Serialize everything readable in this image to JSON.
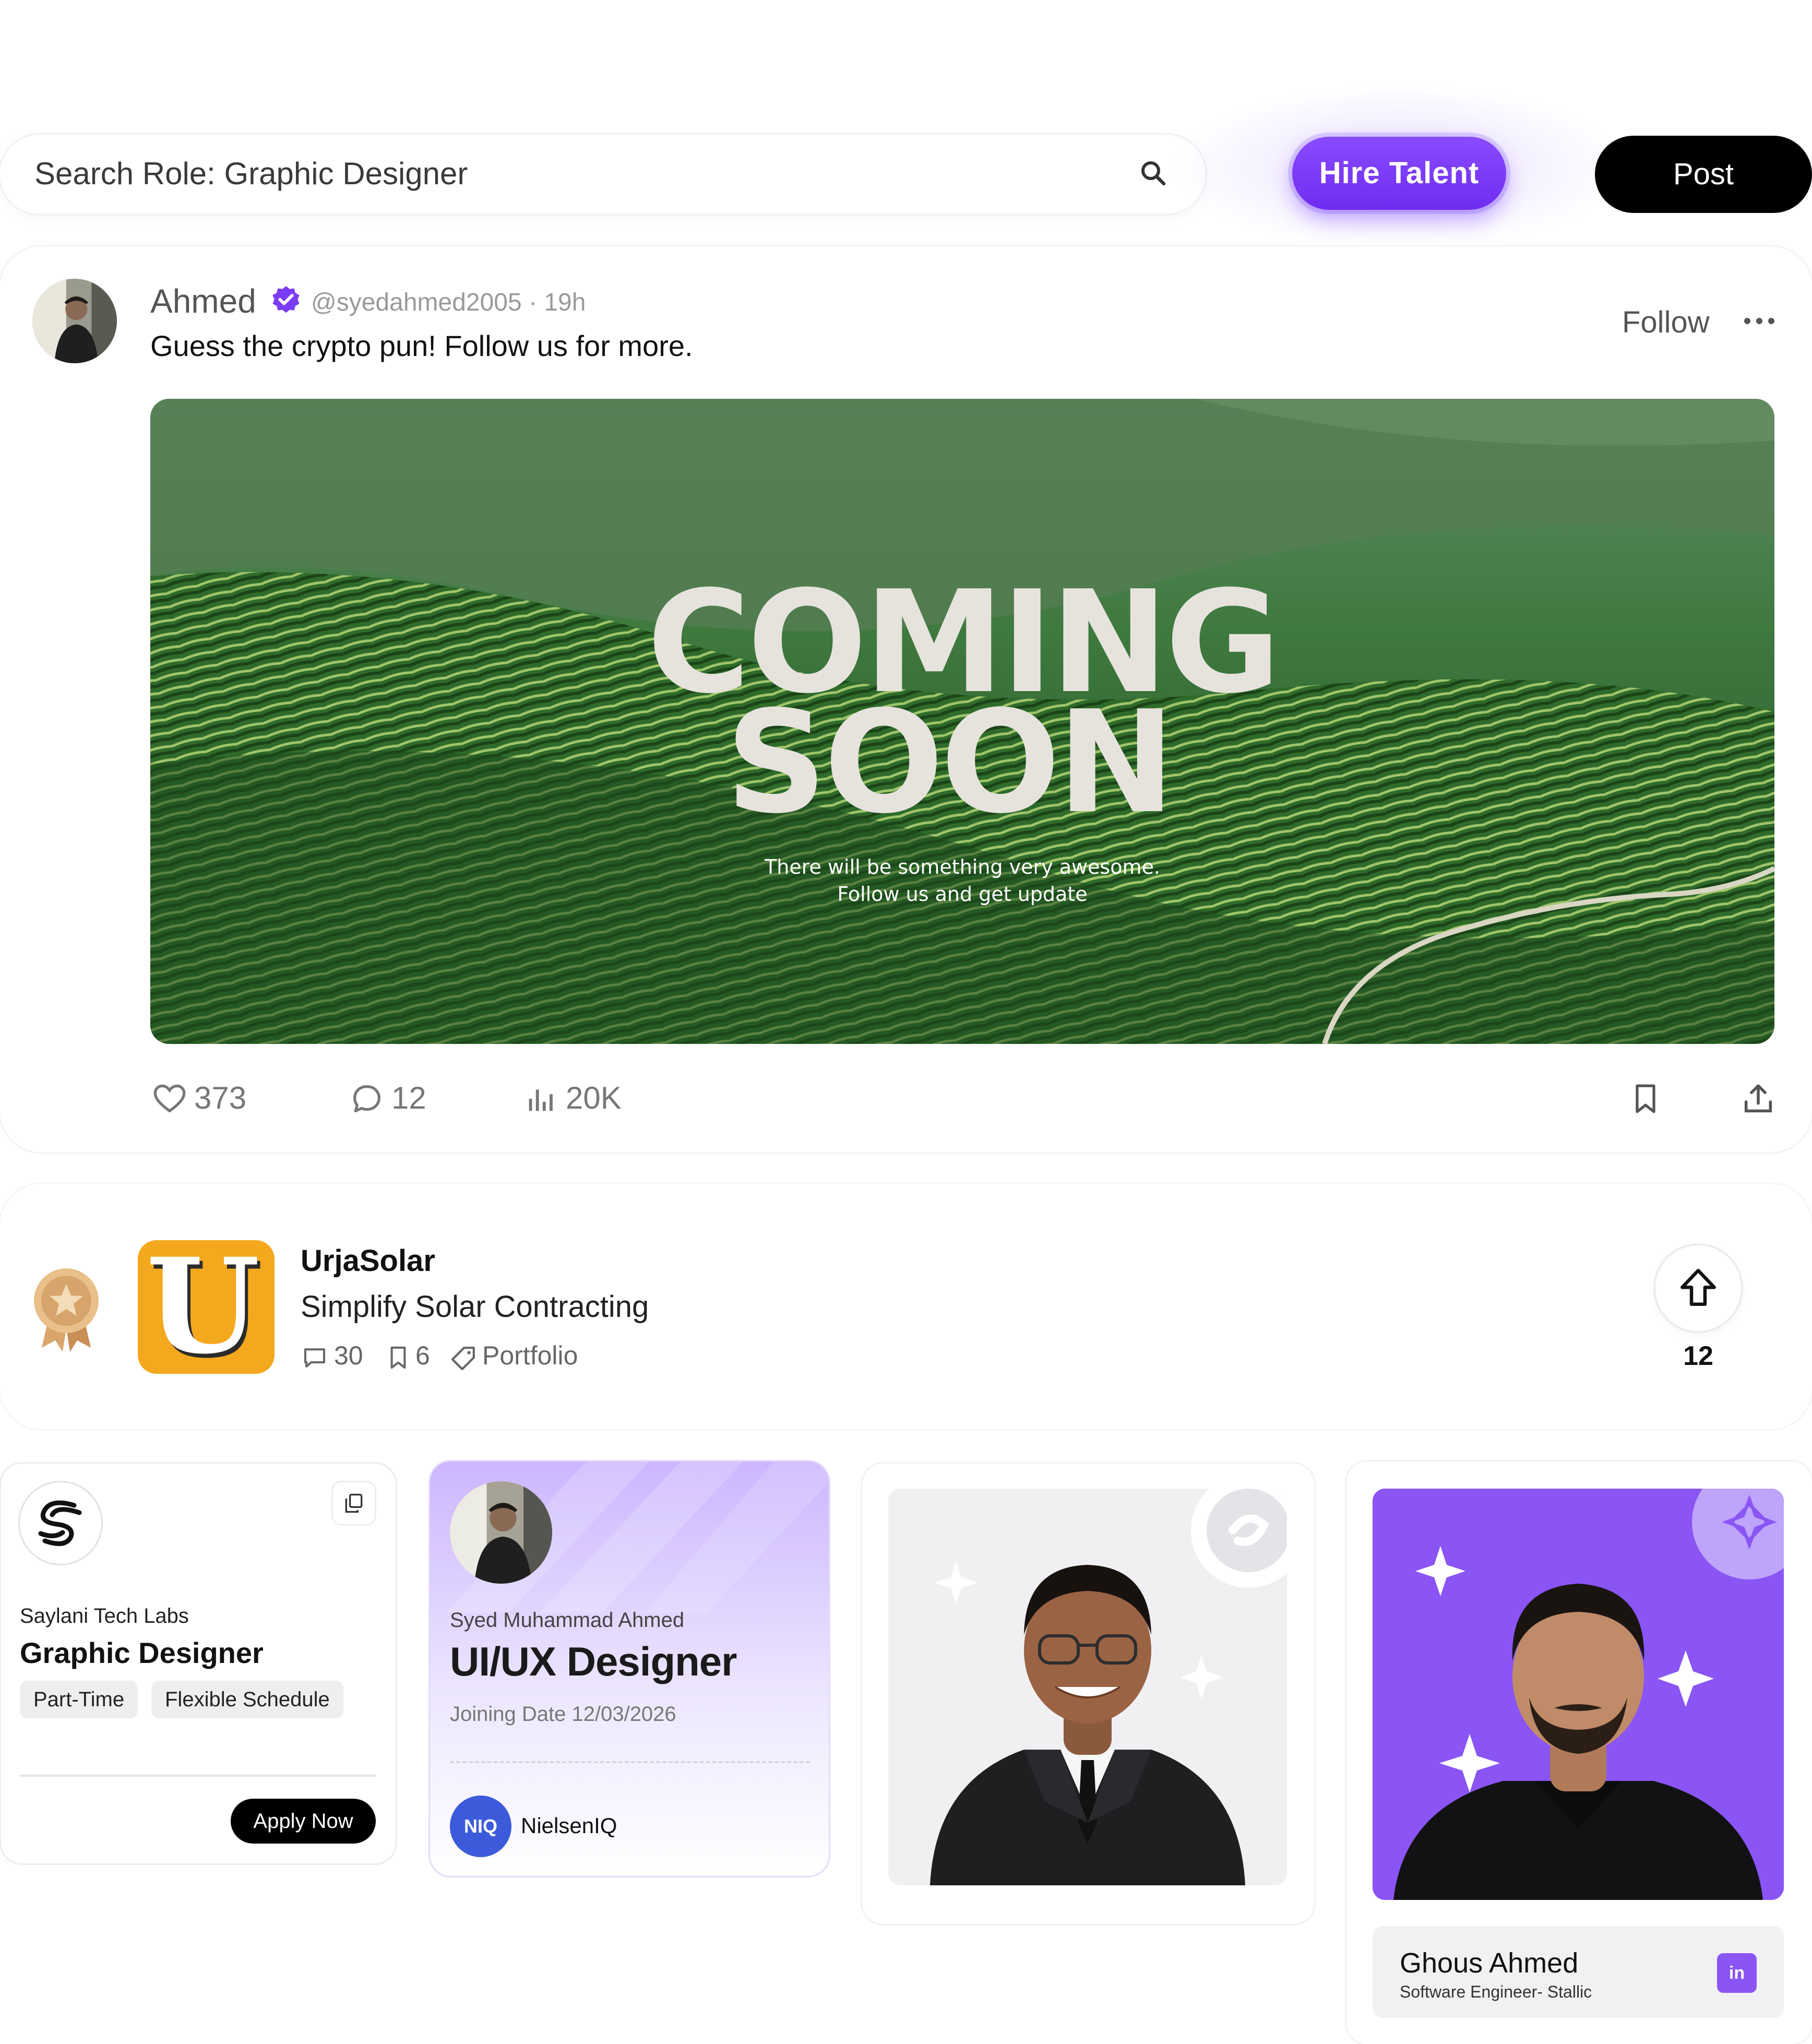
{
  "top_bar": {
    "search_text": "Search Role: Graphic Designer",
    "hire_label": "Hire Talent",
    "post_label": "Post"
  },
  "post": {
    "author_name": "Ahmed",
    "handle_time": "@syedahmed2005 · 19h",
    "text": "Guess the crypto pun! Follow us for more.",
    "follow_label": "Follow",
    "image": {
      "headline_1": "COMING",
      "headline_2": "SOON",
      "sub_1": "There will be something very awesome.",
      "sub_2": "Follow us and get update"
    },
    "likes": "373",
    "comments": "12",
    "views": "20K"
  },
  "product": {
    "name": "UrjaSolar",
    "tagline": "Simplify Solar Contracting",
    "logo_letter": "U",
    "comments": "30",
    "saves": "6",
    "category": "Portfolio",
    "upvotes": "12"
  },
  "job": {
    "company": "Saylani Tech Labs",
    "title": "Graphic Designer",
    "chips": [
      "Part-Time",
      "Flexible Schedule"
    ],
    "apply_label": "Apply Now"
  },
  "offer": {
    "person": "Syed Muhammad Ahmed",
    "role": "UI/UX Designer",
    "date": "Joining Date 12/03/2026",
    "company_logo": "NIQ",
    "company": "NielsenIQ"
  },
  "profile": {
    "name": "Ghous Ahmed",
    "role": "Software Engineer- Stallic",
    "badge": "in"
  },
  "colors": {
    "accent": "#7b3cf5",
    "product_logo_bg": "#f3a81d",
    "niq_blue": "#3b5bdb"
  }
}
